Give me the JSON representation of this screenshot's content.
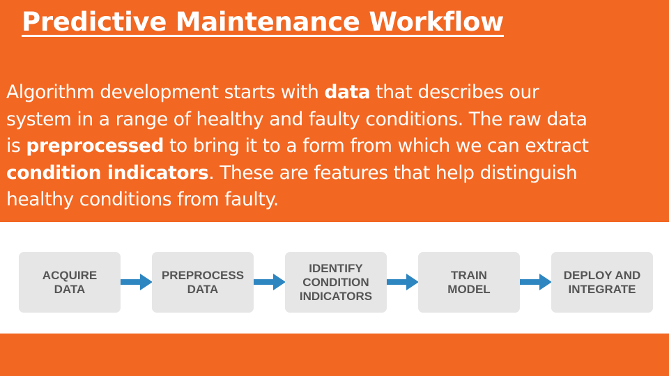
{
  "slide": {
    "title": "Predictive Maintenance Workflow",
    "paragraph": {
      "l1_a": "Algorithm development starts with ",
      "l1_b": "data",
      "l1_c": " that describes our",
      "l2": "system in a range of healthy and faulty conditions. The raw data",
      "l3_a": "is ",
      "l3_b": "preprocessed",
      "l3_c": " to bring it to a form from which we can extract",
      "l4_a": "condition indicators",
      "l4_b": ". These are features that help distinguish",
      "l5": "healthy conditions from faulty."
    }
  },
  "workflow": {
    "steps": [
      {
        "label": "ACQUIRE\nDATA"
      },
      {
        "label": "PREPROCESS\nDATA"
      },
      {
        "label": "IDENTIFY\nCONDITION\nINDICATORS"
      },
      {
        "label": "TRAIN\nMODEL"
      },
      {
        "label": "DEPLOY AND\nINTEGRATE"
      }
    ],
    "colors": {
      "background": "#f26722",
      "step_box": "#e6e6e6",
      "step_text": "#555555",
      "arrow": "#2e86c1"
    }
  }
}
